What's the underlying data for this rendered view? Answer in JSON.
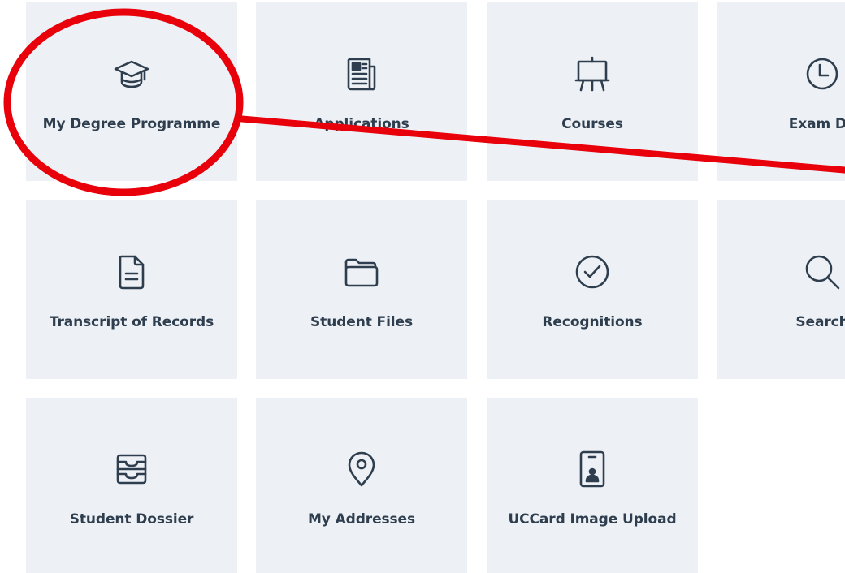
{
  "tiles": {
    "degree": {
      "label": "My Degree Programme",
      "icon": "graduation-cap-icon"
    },
    "apps": {
      "label": "Applications",
      "icon": "newspaper-icon"
    },
    "courses": {
      "label": "Courses",
      "icon": "presentation-board-icon"
    },
    "exam": {
      "label": "Exam Da",
      "icon": "clock-icon"
    },
    "records": {
      "label": "Transcript of Records",
      "icon": "document-icon"
    },
    "files": {
      "label": "Student Files",
      "icon": "folder-icon"
    },
    "recog": {
      "label": "Recognitions",
      "icon": "check-circle-icon"
    },
    "search": {
      "label": "Search",
      "icon": "search-icon"
    },
    "dossier": {
      "label": "Student Dossier",
      "icon": "inbox-tray-icon"
    },
    "address": {
      "label": "My Addresses",
      "icon": "map-pin-icon"
    },
    "uccard": {
      "label": "UCCard Image Upload",
      "icon": "id-card-icon"
    }
  },
  "colors": {
    "tile_background": "#edf1f5",
    "tile_text": "#2f3e4e",
    "annotation_red": "#e8000b"
  }
}
